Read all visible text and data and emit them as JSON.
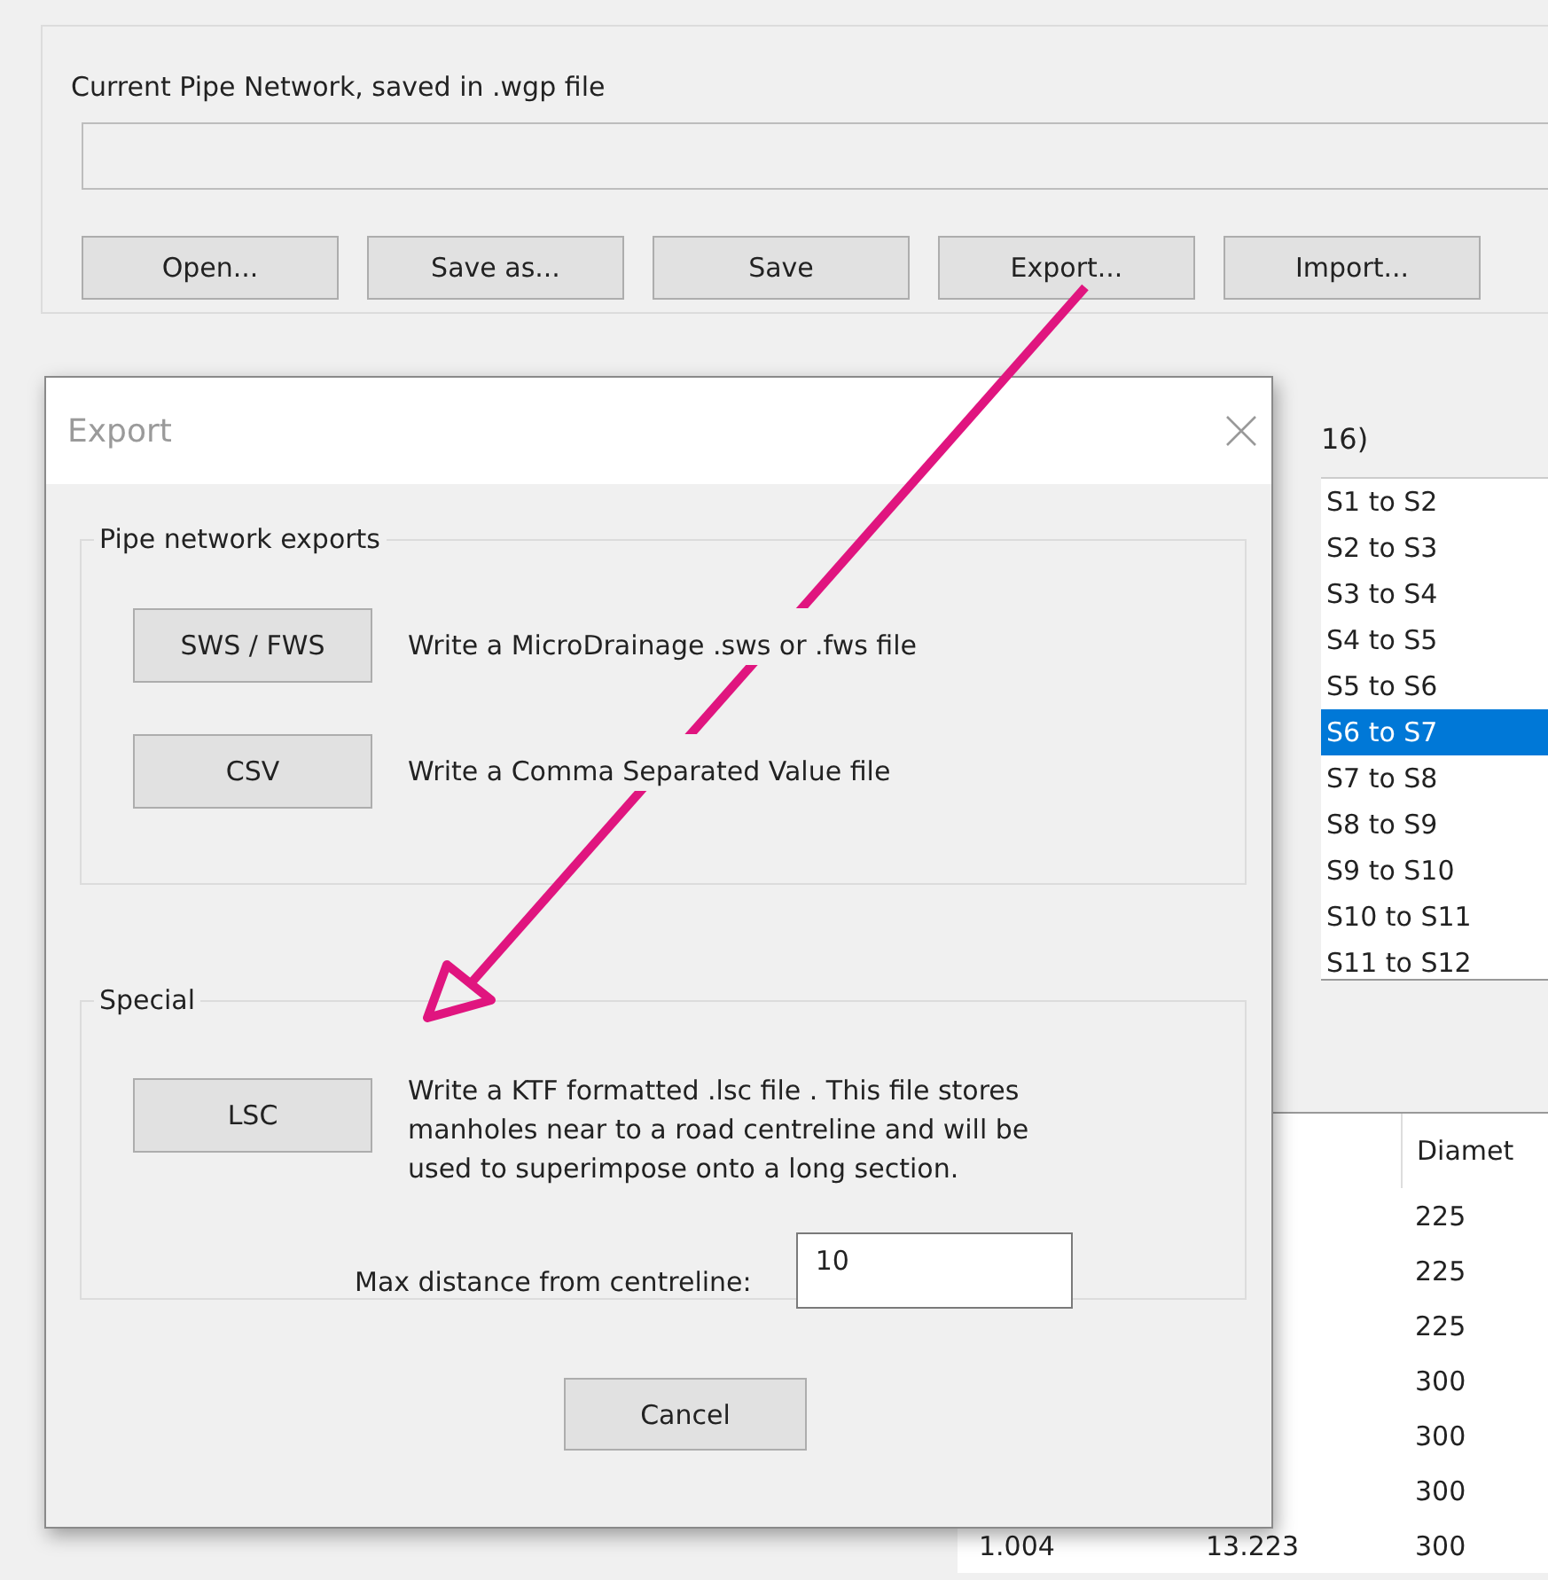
{
  "main_window": {
    "file_group": {
      "label": "Current Pipe Network, saved in .wgp file"
    },
    "buttons": [
      "Open...",
      "Save as...",
      "Save",
      "Export...",
      "Import..."
    ]
  },
  "pipe_list": {
    "title": "16)",
    "items": [
      {
        "label": "S1 to S2",
        "selected": false
      },
      {
        "label": "S2 to S3",
        "selected": false
      },
      {
        "label": "S3 to S4",
        "selected": false
      },
      {
        "label": "S4 to S5",
        "selected": false
      },
      {
        "label": "S5 to S6",
        "selected": false
      },
      {
        "label": "S6 to S7",
        "selected": true
      },
      {
        "label": "S7 to S8",
        "selected": false
      },
      {
        "label": "S8 to S9",
        "selected": false
      },
      {
        "label": "S9 to S10",
        "selected": false
      },
      {
        "label": "S10 to S11",
        "selected": false
      },
      {
        "label": "S11 to S12",
        "selected": false
      }
    ]
  },
  "pipe_table": {
    "column_3_header": "Diamet",
    "rows": [
      {
        "column_3": "225"
      },
      {
        "column_3": "225"
      },
      {
        "column_3": "225"
      },
      {
        "column_3": "300"
      },
      {
        "column_3": "300"
      },
      {
        "column_3": "300"
      },
      {
        "column_1": "1.004",
        "column_2": "13.223",
        "column_3": "300"
      }
    ]
  },
  "dialog": {
    "title": "Export",
    "groups": [
      {
        "title": "Pipe network exports",
        "options": [
          {
            "button": "SWS / FWS",
            "description_lines": [
              "Write a MicroDrainage .sws or .fws file"
            ]
          },
          {
            "button": "CSV",
            "description_lines": [
              "Write a Comma Separated Value file"
            ]
          }
        ]
      },
      {
        "title": "Special",
        "options": [
          {
            "button": "LSC",
            "description_lines": [
              "Write a KTF formatted .lsc file . This file stores",
              "manholes near to a road centreline and will be",
              "used to superimpose onto a long section."
            ]
          }
        ],
        "field": {
          "label": "Max distance from centreline:",
          "value": "10"
        }
      }
    ],
    "cancel": "Cancel"
  }
}
